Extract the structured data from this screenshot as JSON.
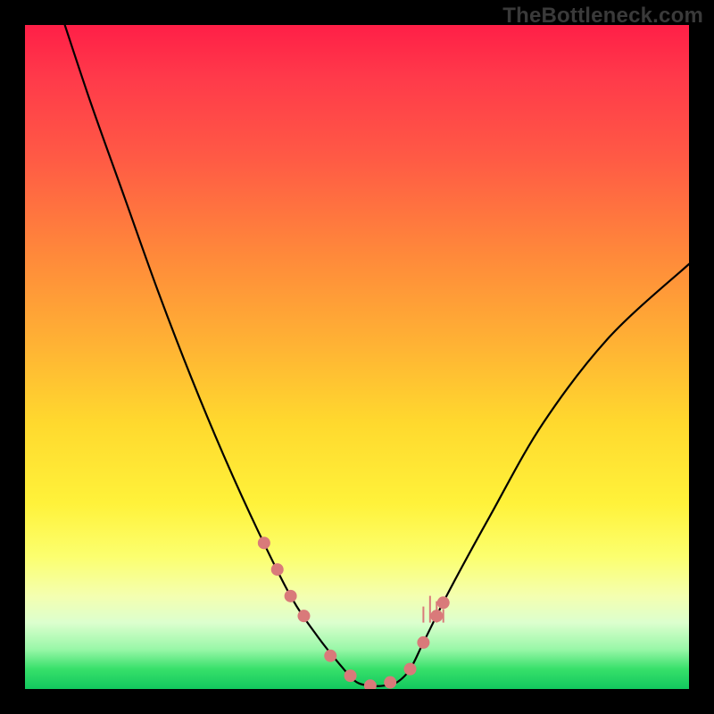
{
  "watermark": "TheBottleneck.com",
  "chart_data": {
    "type": "line",
    "title": "",
    "xlabel": "",
    "ylabel": "",
    "xlim": [
      0,
      100
    ],
    "ylim": [
      0,
      100
    ],
    "series": [
      {
        "name": "bottleneck-curve",
        "x": [
          6,
          10,
          15,
          20,
          25,
          30,
          35,
          40,
          44,
          48,
          50,
          52,
          54,
          56,
          58,
          60,
          64,
          70,
          78,
          88,
          100
        ],
        "y": [
          100,
          88,
          74,
          60,
          47,
          35,
          24,
          14,
          8,
          3,
          1,
          0.5,
          0.5,
          1,
          3,
          7,
          15,
          26,
          40,
          53,
          64
        ]
      }
    ],
    "markers": {
      "name": "highlight-dots",
      "x": [
        36,
        38,
        40,
        42,
        46,
        49,
        52,
        55,
        58,
        60,
        62,
        63
      ],
      "y": [
        22,
        18,
        14,
        11,
        5,
        2,
        0.5,
        1,
        3,
        7,
        11,
        13
      ]
    },
    "spikes": {
      "x": [
        60,
        61,
        62,
        63
      ],
      "h": [
        6,
        10,
        8,
        5
      ]
    }
  }
}
